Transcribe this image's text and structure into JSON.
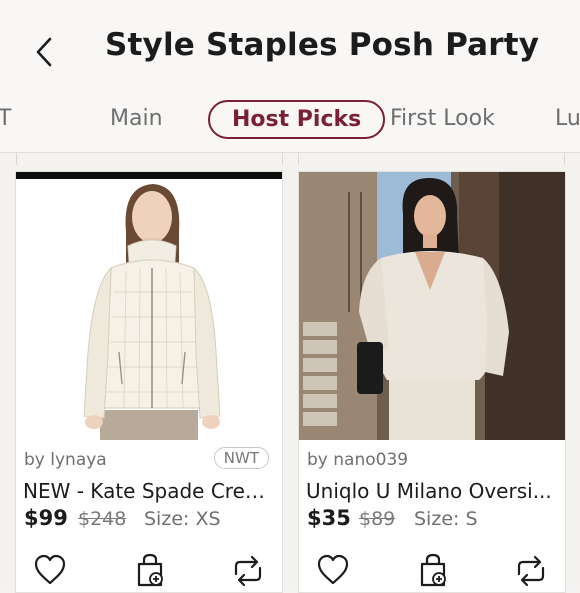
{
  "header": {
    "title": "Style Staples Posh Party"
  },
  "tabs": [
    {
      "label": "T"
    },
    {
      "label": "Main"
    },
    {
      "label": "Host Picks"
    },
    {
      "label": "First Look"
    },
    {
      "label": "Lu"
    }
  ],
  "active_tab": "Host Picks",
  "colors": {
    "accent": "#7b1f36",
    "text": "#1c1c1c",
    "muted": "#6f6f6f"
  },
  "listings": [
    {
      "seller": "by lynaya",
      "badge": "NWT",
      "title": "NEW - Kate Spade Crea...",
      "price": "$99",
      "original_price": "$248",
      "size": "Size: XS"
    },
    {
      "seller": "by nano039",
      "title": "Uniqlo U Milano Oversi...",
      "price": "$35",
      "original_price": "$89",
      "size": "Size: S"
    }
  ]
}
